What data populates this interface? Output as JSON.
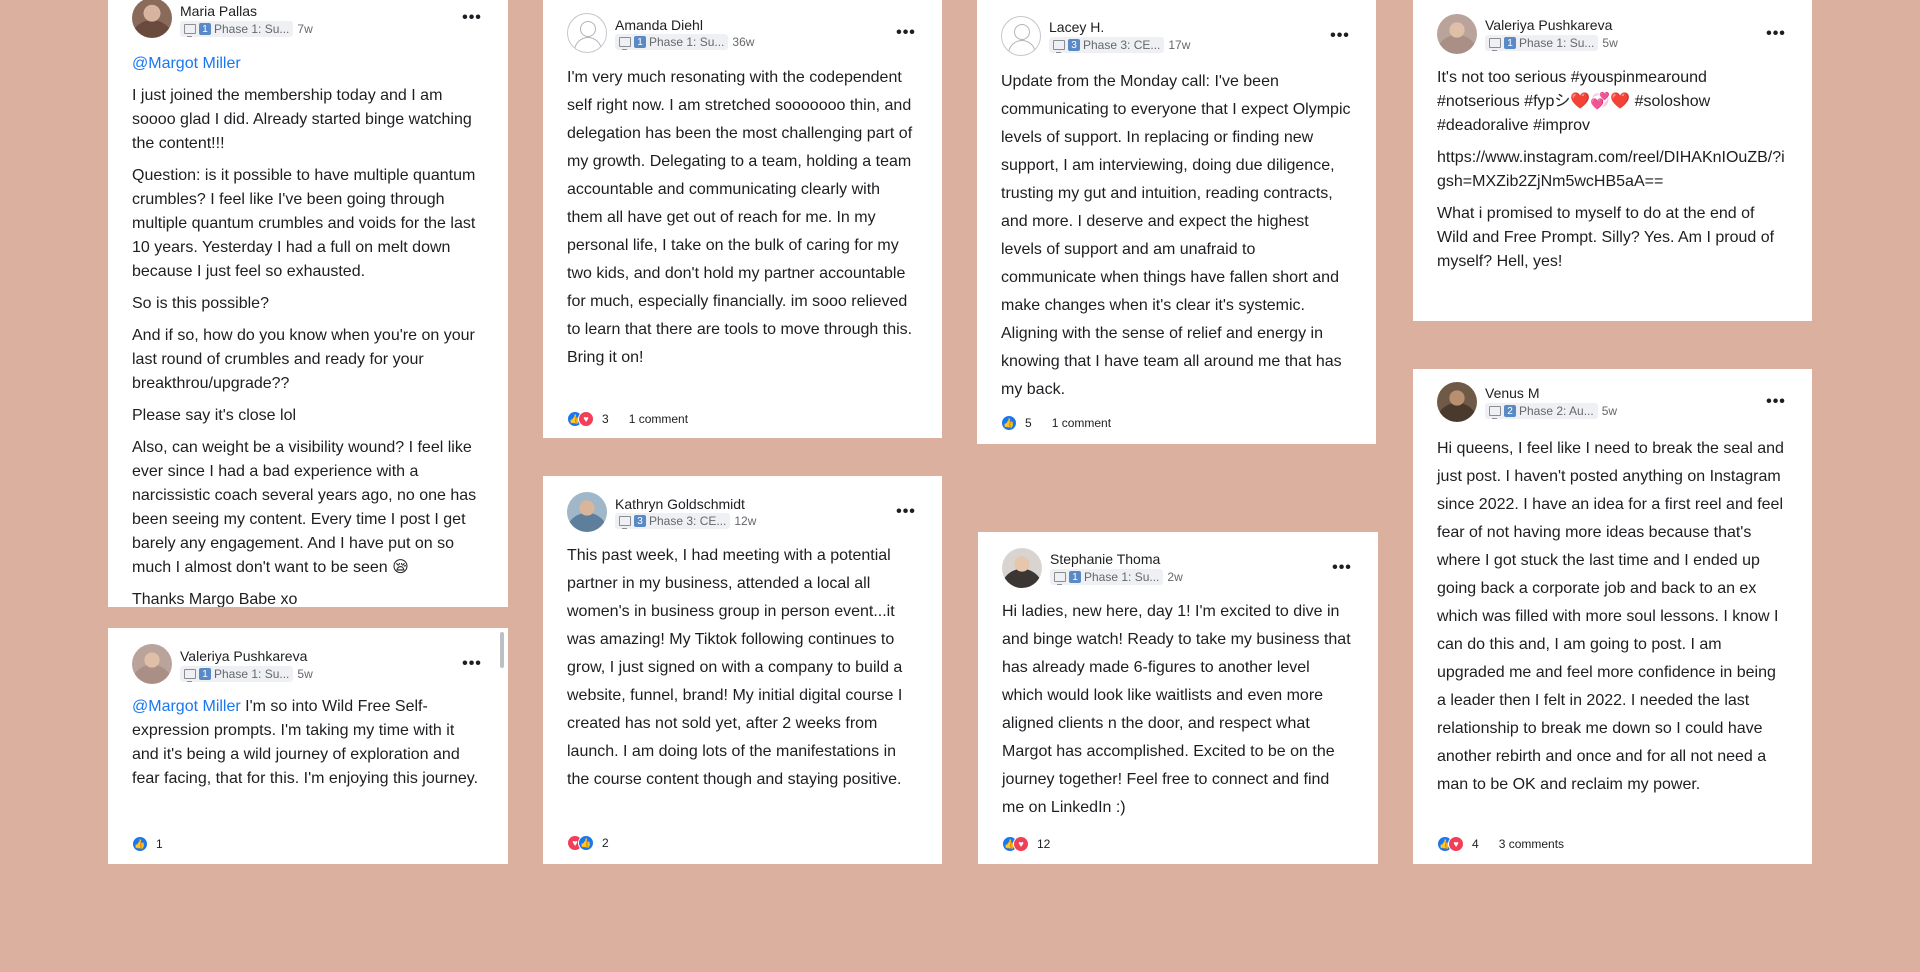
{
  "colors": {
    "page_bg": "#dcb09f",
    "mention": "#1877f2",
    "like": "#1877f2",
    "love": "#f33e58"
  },
  "icons": {
    "menu": "more-dots-icon",
    "course": "monitor-icon",
    "like": "like-icon",
    "love": "love-icon"
  },
  "posts": [
    {
      "author": "Maria Pallas",
      "phase_num": "1",
      "phase": "Phase 1: Su...",
      "time": "7w",
      "mention": "@Margot Miller",
      "paragraphs": [
        "I just joined the membership today and I am soooo glad I did. Already started binge watching the content!!!",
        "Question: is it possible to have multiple quantum crumbles? I feel like I've been going through multiple quantum crumbles and voids for the last 10 years. Yesterday I had a full on melt down because I just feel so exhausted.",
        "So is this possible?",
        "And if so, how do you know when you're on your last round of crumbles and ready for your breakthrou/upgrade??",
        "Please say it's close lol",
        "Also, can weight be a visibility wound? I feel like ever since I had a bad experience with a narcissistic coach several years ago, no one has been seeing my content. Every time I post I get barely any engagement. And I have put on so much I almost don't want to be seen 😪",
        "Thanks Margo Babe xo"
      ]
    },
    {
      "author": "Valeriya Pushkareva",
      "phase_num": "1",
      "phase": "Phase 1: Su...",
      "time": "5w",
      "mention": "@Margot Miller",
      "text": " I'm so into Wild Free Self-expression prompts. I'm taking my time with it and it's being a wild journey of exploration and fear facing, that for this. I'm enjoying this journey.",
      "reactions": "1"
    },
    {
      "author": "Amanda Diehl",
      "phase_num": "1",
      "phase": "Phase 1: Su...",
      "time": "36w",
      "text": "I'm very much resonating with the codependent self right now. I am stretched sooooooo thin, and delegation has been the most challenging part of my growth. Delegating to a team, holding a team accountable and communicating clearly with them all have get out of reach for me. In my personal life, I take on the bulk of caring for my two kids, and don't hold my partner accountable for much, especially financially. im sooo relieved to learn that there are tools to move through this. Bring it on!",
      "reactions": "3",
      "comments": "1 comment"
    },
    {
      "author": "Kathryn Goldschmidt",
      "phase_num": "3",
      "phase": "Phase 3: CE...",
      "time": "12w",
      "text": "This past week, I had meeting with a potential partner in my business, attended a local all women's in business group in person event...it was amazing! My Tiktok following continues to grow, I just signed on with a company to build a website, funnel, brand! My initial digital course I created has not sold yet, after 2 weeks from launch. I am doing lots of the manifestations in the course content though and staying positive.",
      "reactions": "2"
    },
    {
      "author": "Lacey H.",
      "phase_num": "3",
      "phase": "Phase 3: CE...",
      "time": "17w",
      "text": "Update from the Monday call: I've been communicating to everyone that I expect Olympic levels of support. In replacing or finding new support, I am interviewing, doing due diligence, trusting my gut and intuition, reading contracts, and more. I deserve and expect the highest levels of support and am unafraid to communicate when things have fallen short and make changes when it's clear it's systemic. Aligning with the sense of relief and energy in knowing that I have team all around me that has my back.",
      "reactions": "5",
      "comments": "1 comment"
    },
    {
      "author": "Stephanie Thoma",
      "phase_num": "1",
      "phase": "Phase 1: Su...",
      "time": "2w",
      "text": "Hi ladies, new here, day 1! I'm excited to dive in and binge watch! Ready to take my business that has already made 6-figures to another level which would look like waitlists and even more aligned clients n the door, and respect what Margot has accomplished. Excited to be on the journey together! Feel free to connect and find me on LinkedIn :)",
      "reactions": "12"
    },
    {
      "author": "Valeriya Pushkareva",
      "phase_num": "1",
      "phase": "Phase 1: Su...",
      "time": "5w",
      "paragraphs": [
        "It's not too serious #youspinmearound #notserious #fypシ❤️💞❤️ #soloshow #deadoralive #improv",
        "https://www.instagram.com/reel/DIHAKnIOuZB/?igsh=MXZib2ZjNm5wcHB5aA==",
        "What i promised to myself to do at the end of Wild and Free Prompt. Silly? Yes. Am I proud of myself? Hell, yes!"
      ]
    },
    {
      "author": "Venus M",
      "phase_num": "2",
      "phase": "Phase 2: Au...",
      "time": "5w",
      "text": "Hi queens, I feel like I need to break the seal and just post. I haven't posted anything on Instagram since 2022. I have an idea for a first reel and feel fear of not having more ideas because that's where I got stuck the last time and I ended up going back a corporate job and back to an ex which was filled with more soul lessons. I know I can do this and, I am going to post. I am upgraded me and feel more confidence in being a leader then I felt in 2022. I needed the last relationship to break me down so I could have another rebirth and once and for all not need a man to be OK and reclaim my power.",
      "reactions": "4",
      "comments": "3 comments"
    }
  ]
}
